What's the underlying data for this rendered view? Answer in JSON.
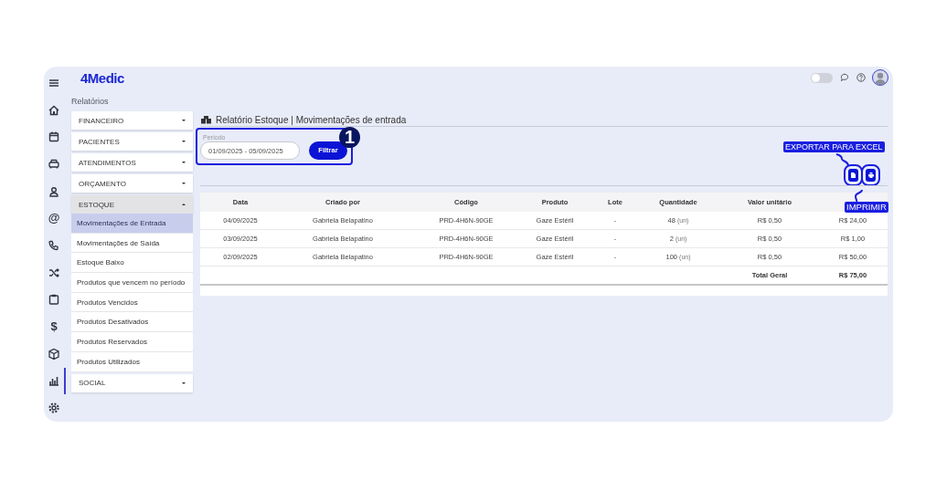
{
  "app": {
    "logo": "4Medic"
  },
  "topbar": {
    "theme_toggle": {
      "on": false
    }
  },
  "rail": [
    {
      "kind": "icon",
      "selected": false
    },
    {
      "kind": "icon",
      "selected": false
    },
    {
      "kind": "icon",
      "selected": false
    },
    {
      "kind": "icon",
      "selected": false
    },
    {
      "kind": "icon",
      "selected": false
    },
    {
      "kind": "glyph",
      "glyph": "@",
      "selected": false
    },
    {
      "kind": "icon",
      "selected": false
    },
    {
      "kind": "icon",
      "selected": false
    },
    {
      "kind": "icon",
      "selected": false
    },
    {
      "kind": "glyph",
      "glyph": "$",
      "selected": false
    },
    {
      "kind": "icon",
      "selected": false
    },
    {
      "kind": "icon",
      "selected": true
    },
    {
      "kind": "icon",
      "selected": false
    }
  ],
  "sidebar": {
    "title": "Relatórios",
    "items": [
      {
        "label": "FINANCEIRO",
        "expanded": false
      },
      {
        "label": "PACIENTES",
        "expanded": false
      },
      {
        "label": "ATENDIMENTOS",
        "expanded": false
      },
      {
        "label": "ORÇAMENTO",
        "expanded": false
      },
      {
        "label": "ESTOQUE",
        "expanded": true,
        "children": [
          {
            "label": "Movimentações de Entrada",
            "selected": true
          },
          {
            "label": "Movimentações de Saída",
            "selected": false
          },
          {
            "label": "Estoque Baixo",
            "selected": false
          },
          {
            "label": "Produtos que vencem no período",
            "selected": false
          },
          {
            "label": "Produtos Vencidos",
            "selected": false
          },
          {
            "label": "Produtos Desativados",
            "selected": false
          },
          {
            "label": "Produtos Reservados",
            "selected": false
          },
          {
            "label": "Produtos Utilizados",
            "selected": false
          }
        ]
      },
      {
        "label": "SOCIAL",
        "expanded": false
      }
    ]
  },
  "report": {
    "title": "Relatório Estoque | Movimentações de entrada",
    "filter": {
      "label": "Período",
      "value": "01/09/2025 - 05/09/2025",
      "button": "Filtrar"
    },
    "table": {
      "columns": [
        "Data",
        "Criado por",
        "Código",
        "Produto",
        "Lote",
        "Quantidade",
        "Valor unitário"
      ],
      "rows": [
        {
          "date": "04/09/2025",
          "created_by": "Gabriela Belapatino",
          "code": "PRD-4H6N-90GE",
          "product": "Gaze Estéril",
          "batch": "-",
          "quantity": "48",
          "unit": "(un)",
          "unit_value": "R$ 0,50",
          "total": "R$ 24,00"
        },
        {
          "date": "03/09/2025",
          "created_by": "Gabriela Belapatino",
          "code": "PRD-4H6N-90GE",
          "product": "Gaze Estéril",
          "batch": "-",
          "quantity": "2",
          "unit": "(un)",
          "unit_value": "R$ 0,50",
          "total": "R$ 1,00"
        },
        {
          "date": "02/09/2025",
          "created_by": "Gabriela Belapatino",
          "code": "PRD-4H6N-90GE",
          "product": "Gaze Estéril",
          "batch": "-",
          "quantity": "100",
          "unit": "(un)",
          "unit_value": "R$ 0,50",
          "total": "R$ 50,00"
        }
      ],
      "total_label": "Total Geral",
      "total_value": "R$ 75,00"
    }
  },
  "annotations": {
    "step": "1",
    "export_label": "EXPORTAR PARA EXCEL",
    "print_label": "IMPRIMIR"
  }
}
